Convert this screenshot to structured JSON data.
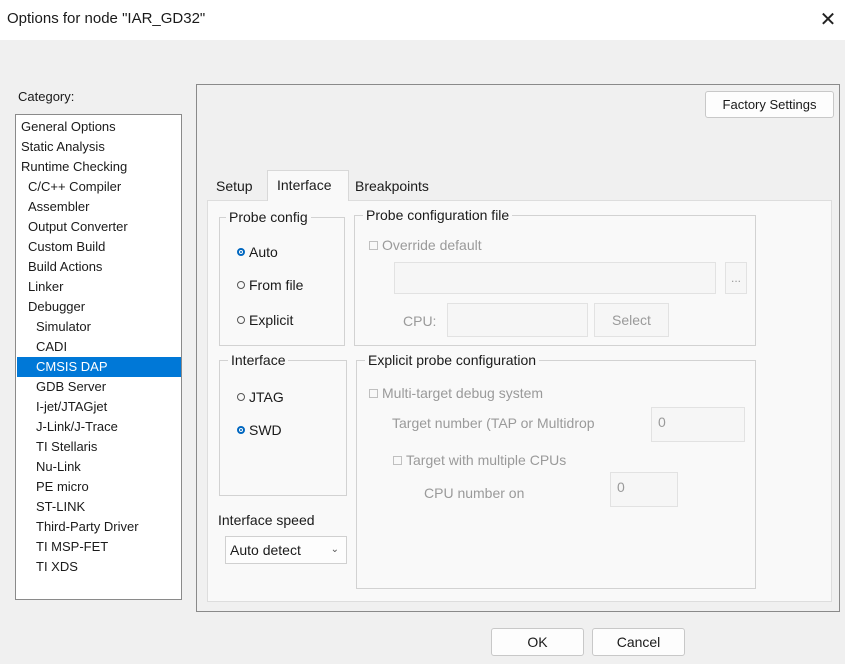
{
  "window": {
    "title": "Options for node \"IAR_GD32\"",
    "close_glyph": "✕"
  },
  "category": {
    "label": "Category:",
    "items": [
      "General Options",
      "Static Analysis",
      "Runtime Checking",
      "C/C++ Compiler",
      "Assembler",
      "Output Converter",
      "Custom Build",
      "Build Actions",
      "Linker",
      "Debugger",
      "Simulator",
      "CADI",
      "CMSIS DAP",
      "GDB Server",
      "I-jet/JTAGjet",
      "J-Link/J-Trace",
      "TI Stellaris",
      "Nu-Link",
      "PE micro",
      "ST-LINK",
      "Third-Party Driver",
      "TI MSP-FET",
      "TI XDS"
    ],
    "selected": "CMSIS DAP"
  },
  "factory_settings_label": "Factory Settings",
  "tabs": [
    {
      "label": "Setup"
    },
    {
      "label": "Interface"
    },
    {
      "label": "Breakpoints"
    }
  ],
  "active_tab": "Interface",
  "probe_config": {
    "title": "Probe config",
    "options": [
      {
        "label": "Auto",
        "selected": true
      },
      {
        "label": "From file",
        "selected": false
      },
      {
        "label": "Explicit",
        "selected": false
      }
    ]
  },
  "probe_config_file": {
    "title": "Probe configuration file",
    "override_label": "Override default",
    "browse_label": "...",
    "cpu_label": "CPU:",
    "select_label": "Select"
  },
  "interface": {
    "title": "Interface",
    "options": [
      {
        "label": "JTAG",
        "selected": false
      },
      {
        "label": "SWD",
        "selected": true
      }
    ]
  },
  "explicit_probe": {
    "title": "Explicit probe configuration",
    "multi_target_label": "Multi-target debug system",
    "target_number_label": "Target number (TAP or Multidrop",
    "target_number_value": "0",
    "multi_cpu_label": "Target with multiple CPUs",
    "cpu_number_label": "CPU number on",
    "cpu_number_value": "0"
  },
  "interface_speed": {
    "label": "Interface speed",
    "value": "Auto detect",
    "chevron": "⌄"
  },
  "buttons": {
    "ok": "OK",
    "cancel": "Cancel"
  },
  "colors": {
    "selection": "#0078d7",
    "radio_accent": "#0067c0"
  }
}
